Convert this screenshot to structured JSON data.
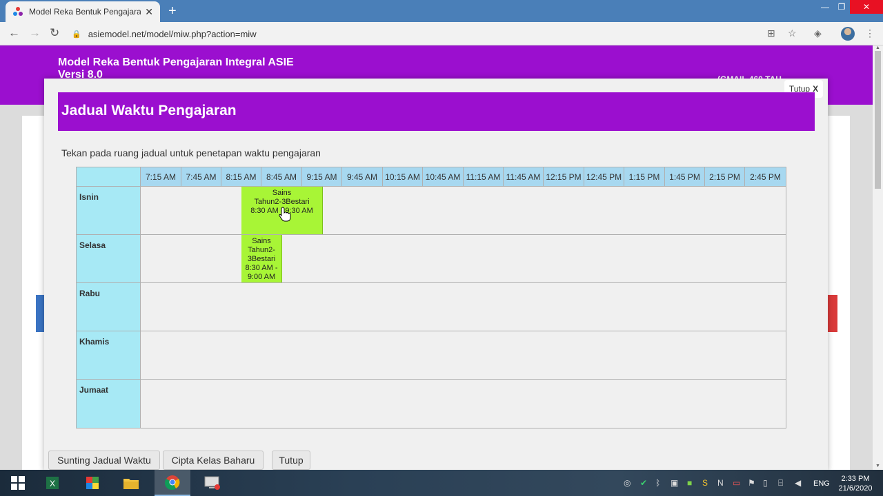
{
  "browser": {
    "tab_title": "Model Reka Bentuk Pengajaran I",
    "url": "asiemodel.net/model/miw.php?action=miw",
    "new_tab": "+",
    "tab_close": "✕"
  },
  "site": {
    "title_line1": "Model Reka Bentuk Pengajaran Integral ASIE",
    "title_line2": "Versi 8.0",
    "header_right": "(GMAIL 460 TAH"
  },
  "modal": {
    "close_label": "Tutup",
    "close_x": "X",
    "title": "Jadual Waktu Pengajaran",
    "instruction": "Tekan pada ruang jadual untuk penetapan waktu pengajaran"
  },
  "timetable": {
    "times": [
      "7:15 AM",
      "7:45 AM",
      "8:15 AM",
      "8:45 AM",
      "9:15 AM",
      "9:45 AM",
      "10:15 AM",
      "10:45 AM",
      "11:15 AM",
      "11:45 AM",
      "12:15 PM",
      "12:45 PM",
      "1:15 PM",
      "1:45 PM",
      "2:15 PM",
      "2:45 PM"
    ],
    "days": [
      "Isnin",
      "Selasa",
      "Rabu",
      "Khamis",
      "Jumaat"
    ],
    "slots": {
      "isnin": {
        "line1": "Sains",
        "line2": "Tahun2-3Bestari",
        "line3": "8:30 AM - 9:30 AM"
      },
      "selasa": {
        "line1": "Sains",
        "line2": "Tahun2-",
        "line3": "3Bestari",
        "line4": "8:30 AM -",
        "line5": "9:00 AM"
      }
    },
    "slot_color": "#a8f536"
  },
  "buttons": {
    "edit": "Sunting Jadual Waktu",
    "create": "Cipta Kelas Baharu",
    "close": "Tutup"
  },
  "taskbar": {
    "lang": "ENG",
    "time": "2:33 PM",
    "date": "21/6/2020"
  },
  "colors": {
    "brand_purple": "#9b0fcf",
    "header_cell": "#a7d8f0",
    "day_cell": "#a7e9f5"
  }
}
